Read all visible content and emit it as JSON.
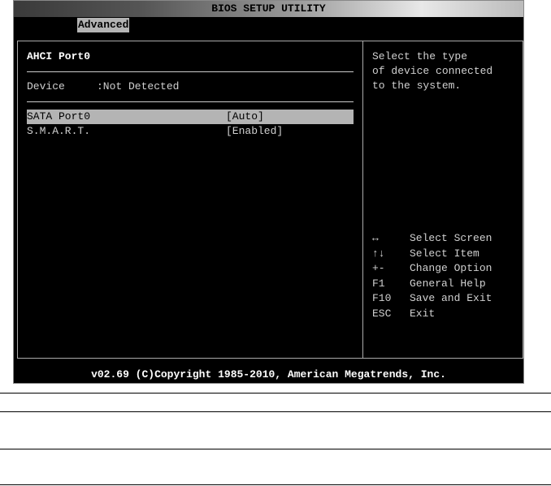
{
  "title": "BIOS SETUP UTILITY",
  "tab": "Advanced",
  "section_title": "AHCI Port0",
  "device": {
    "label": "Device",
    "value": ":Not Detected"
  },
  "items": [
    {
      "label": "SATA Port0",
      "value": "[Auto]",
      "selected": true
    },
    {
      "label": "S.M.A.R.T.",
      "value": "[Enabled]",
      "selected": false
    }
  ],
  "help": [
    "Select the type",
    "of device connected",
    "to the system."
  ],
  "keys": [
    {
      "key": "↔",
      "desc": "Select Screen"
    },
    {
      "key": "↑↓",
      "desc": "Select Item"
    },
    {
      "key": "+-",
      "desc": "Change Option"
    },
    {
      "key": "F1",
      "desc": "General Help"
    },
    {
      "key": "F10",
      "desc": "Save and Exit"
    },
    {
      "key": "ESC",
      "desc": "Exit"
    }
  ],
  "footer": "v02.69 (C)Copyright 1985-2010, American Megatrends, Inc."
}
